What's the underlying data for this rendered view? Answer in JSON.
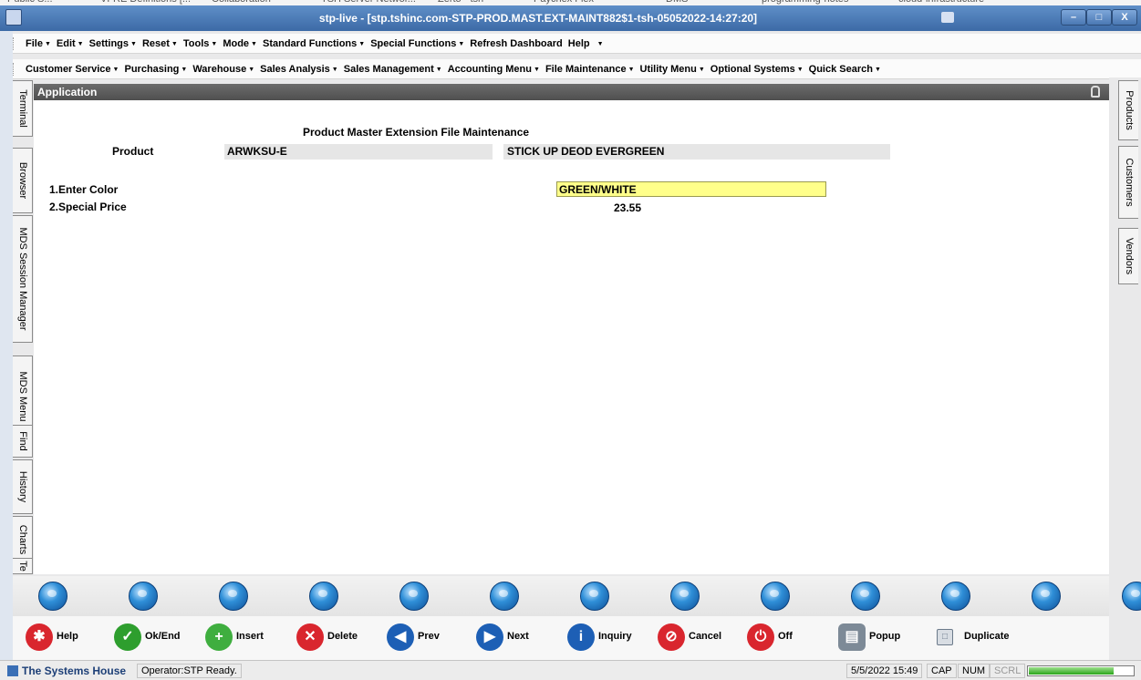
{
  "bookmarks": [
    "Public S...",
    "VFRE Definitions [...",
    "Collaboration",
    "TSH Server Networ...",
    "Zerto - tsh",
    "Paychex Flex",
    "DMS",
    "programming-notes",
    "cloud-infrastructure"
  ],
  "window": {
    "title": "stp-live - [stp.tshinc.com-STP-PROD.MAST.EXT-MAINT882$1-tsh-05052022-14:27:20]",
    "minimize": "–",
    "maximize": "□",
    "close": "X"
  },
  "menu1": [
    "File",
    "Edit",
    "Settings",
    "Reset",
    "Tools",
    "Mode",
    "Standard Functions",
    "Special Functions",
    "Refresh Dashboard",
    "Help"
  ],
  "menu1_has_arrow": [
    true,
    true,
    true,
    true,
    true,
    true,
    true,
    true,
    false,
    false
  ],
  "menu2": [
    "Customer Service",
    "Purchasing",
    "Warehouse",
    "Sales Analysis",
    "Sales Management",
    "Accounting Menu",
    "File Maintenance",
    "Utility Menu",
    "Optional Systems",
    "Quick Search"
  ],
  "left_tabs": [
    "Terminal",
    "Browser",
    "MDS Session Manager",
    "MDS Menu",
    "Find",
    "History",
    "Charts",
    "Te"
  ],
  "right_tabs": [
    "Products",
    "Customers",
    "Vendors"
  ],
  "app": {
    "header": "Application",
    "form_title": "Product Master Extension File Maintenance",
    "product_label": "Product",
    "product_code": "ARWKSU-E",
    "product_desc": "STICK UP DEOD EVERGREEN",
    "field1_label": "1.Enter Color",
    "field1_value": "GREEN/WHITE",
    "field2_label": "2.Special Price",
    "field2_value": "23.55"
  },
  "function_keys": [
    {
      "label": "Help",
      "color": "#d9262e"
    },
    {
      "label": "Ok/End",
      "color": "#2e9e2e"
    },
    {
      "label": "Insert",
      "color": "#3fae3f"
    },
    {
      "label": "Delete",
      "color": "#d9262e"
    },
    {
      "label": "Prev",
      "color": "#1d5fb5"
    },
    {
      "label": "Next",
      "color": "#1d5fb5"
    },
    {
      "label": "Inquiry",
      "color": "#1d5fb5"
    },
    {
      "label": "Cancel",
      "color": "#d9262e"
    },
    {
      "label": "Off",
      "color": "#d9262e"
    },
    {
      "label": "Popup",
      "color": "#7d8a97"
    },
    {
      "label": "Duplicate",
      "color": "#d8dde3"
    }
  ],
  "status": {
    "company": "The Systems House",
    "operator": "Operator:STP Ready.",
    "datetime": "5/5/2022 15:49",
    "cap": "CAP",
    "num": "NUM",
    "scrl": "SCRL",
    "progress": 0.8
  }
}
